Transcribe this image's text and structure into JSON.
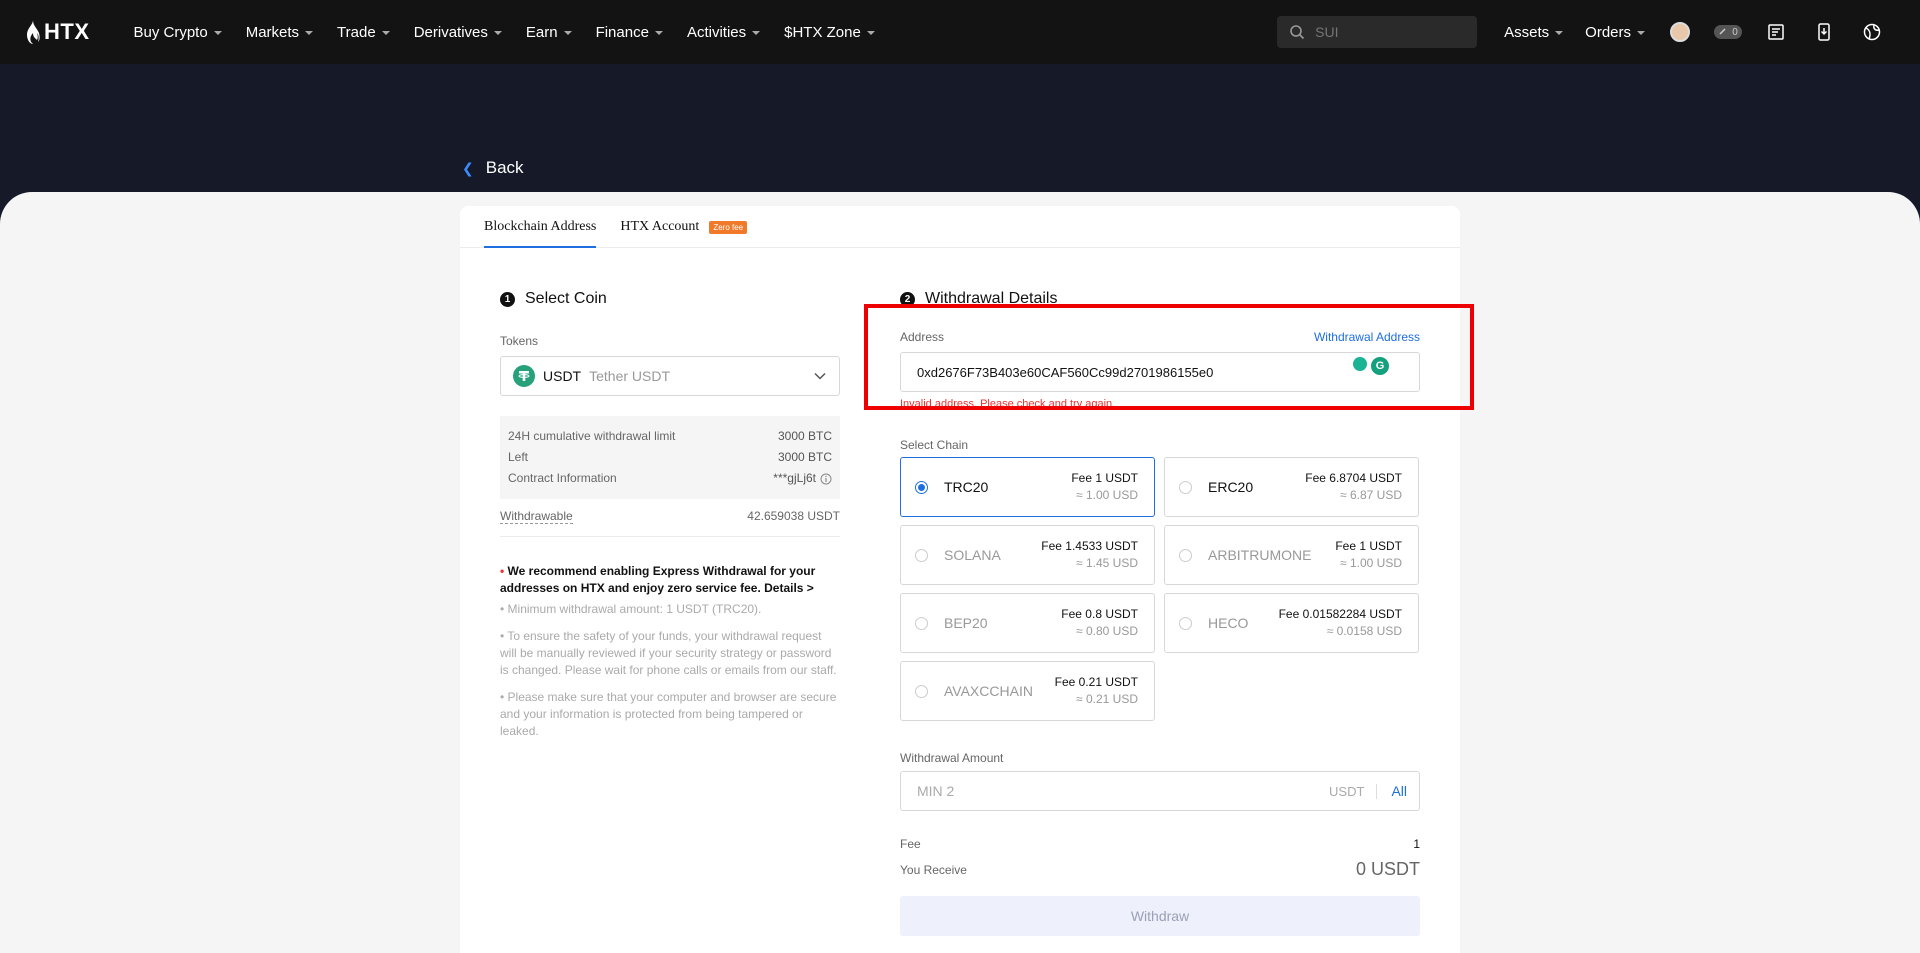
{
  "nav": {
    "brand": "HTX",
    "items": [
      "Buy Crypto",
      "Markets",
      "Trade",
      "Derivatives",
      "Earn",
      "Finance",
      "Activities",
      "$HTX Zone"
    ],
    "search_placeholder": "SUI",
    "right_items": [
      "Assets",
      "Orders"
    ],
    "notif_count": "0"
  },
  "back": "Back",
  "tabs": {
    "blockchain": "Blockchain Address",
    "htx_account": "HTX Account",
    "zero_fee": "Zero fee"
  },
  "select_coin": {
    "step": "1",
    "title": "Select Coin",
    "tokens_label": "Tokens",
    "token_symbol": "USDT",
    "token_name": "Tether USDT",
    "limit_label": "24H cumulative withdrawal limit",
    "limit_value": "3000 BTC",
    "left_label": "Left",
    "left_value": "3000 BTC",
    "contract_label": "Contract Information",
    "contract_value": "***gjLj6t",
    "withdrawable_label": "Withdrawable",
    "withdrawable_value": "42.659038 USDT",
    "note_express": "We recommend enabling Express Withdrawal for your addresses on HTX and enjoy zero service fee. Details >",
    "note_min": "• Minimum withdrawal amount: 1 USDT (TRC20).",
    "note_safety": "• To ensure the safety of your funds, your withdrawal request will be manually reviewed if your security strategy or password is changed. Please wait for phone calls or emails from our staff.",
    "note_secure": "• Please make sure that your computer and browser are secure and your information is protected from being tampered or leaked."
  },
  "details": {
    "step": "2",
    "title": "Withdrawal Details",
    "address_label": "Address",
    "address_link": "Withdrawal Address",
    "address_value": "0xd2676F73B403e60CAF560Cc99d2701986155e0",
    "address_error": "Invalid address. Please check and try again.",
    "chain_label": "Select Chain",
    "chains": [
      {
        "name": "TRC20",
        "fee": "Fee 1 USDT",
        "usd": "≈ 1.00 USD"
      },
      {
        "name": "ERC20",
        "fee": "Fee 6.8704 USDT",
        "usd": "≈ 6.87 USD"
      },
      {
        "name": "SOLANA",
        "fee": "Fee 1.4533 USDT",
        "usd": "≈ 1.45 USD"
      },
      {
        "name": "ARBITRUMONE",
        "fee": "Fee 1 USDT",
        "usd": "≈ 1.00 USD"
      },
      {
        "name": "BEP20",
        "fee": "Fee 0.8 USDT",
        "usd": "≈ 0.80 USD"
      },
      {
        "name": "HECO",
        "fee": "Fee 0.01582284 USDT",
        "usd": "≈ 0.0158 USD"
      },
      {
        "name": "AVAXCCHAIN",
        "fee": "Fee 0.21 USDT",
        "usd": "≈ 0.21 USD"
      }
    ],
    "amount_label": "Withdrawal Amount",
    "amount_placeholder": "MIN 2",
    "amount_unit": "USDT",
    "amount_all": "All",
    "fee_label": "Fee",
    "fee_value": "1",
    "receive_label": "You Receive",
    "receive_value": "0 USDT",
    "withdraw_button": "Withdraw"
  },
  "colors": {
    "accent": "#1f6fe0",
    "error": "#e33333",
    "highlight": "#ee0000",
    "header": "#131313"
  }
}
